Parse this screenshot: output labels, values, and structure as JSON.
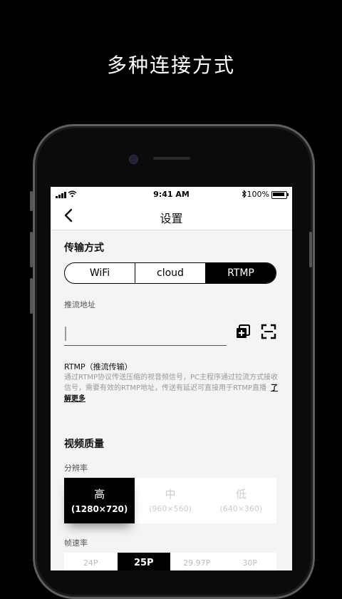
{
  "headline": "多种连接方式",
  "status": {
    "time": "9:41 AM",
    "battery": "100%"
  },
  "nav": {
    "title": "设置"
  },
  "transport": {
    "title": "传输方式",
    "options": [
      "WiFi",
      "cloud",
      "RTMP"
    ],
    "selected": "RTMP"
  },
  "stream": {
    "label": "推流地址",
    "value": "",
    "rtmp_title": "RTMP（推流传输）",
    "rtmp_desc": "通过RTMP协议传送压缩的视音频信号，PC主程序通过拉流方式接收信号，需要有效的RTMP地址，传送有延迟可直接用于RTMP直播",
    "learn_more": "了解更多"
  },
  "video": {
    "title": "视频质量",
    "resolution_label": "分辨率",
    "resolutions": [
      {
        "name": "高",
        "size": "(1280×720)"
      },
      {
        "name": "中",
        "size": "(960×560)"
      },
      {
        "name": "低",
        "size": "(640×360)"
      }
    ],
    "resolution_selected": "高",
    "fps_label": "帧速率",
    "fps": [
      "24P",
      "25P",
      "29.97P",
      "30P"
    ],
    "fps_selected": "25P"
  },
  "icons": {
    "back": "chevron-left-icon",
    "paste": "paste-icon",
    "scan": "scan-icon",
    "bluetooth": "bluetooth-icon",
    "wifi": "wifi-icon"
  }
}
